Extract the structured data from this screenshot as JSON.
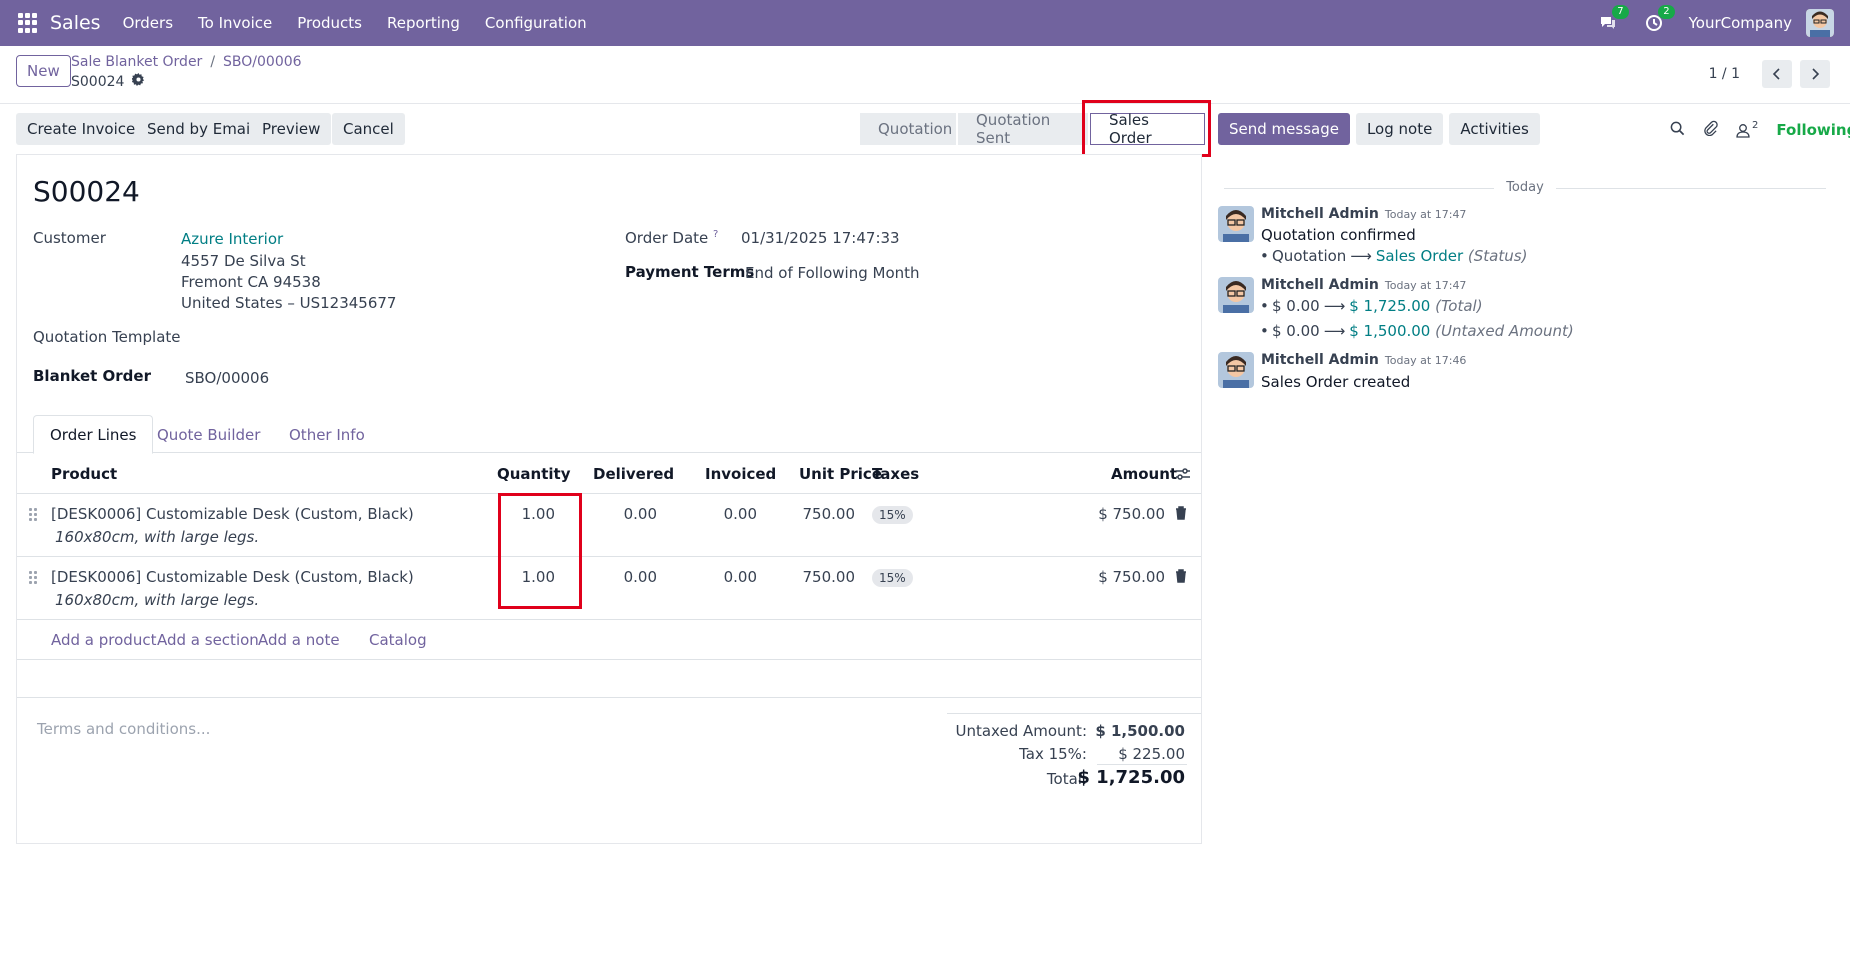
{
  "navbar": {
    "app": "Sales",
    "menu": [
      "Orders",
      "To Invoice",
      "Products",
      "Reporting",
      "Configuration"
    ],
    "messages_count": "7",
    "activities_count": "2",
    "company": "YourCompany"
  },
  "control_panel": {
    "new_label": "New",
    "breadcrumb_parent": "Sale Blanket Order",
    "breadcrumb_separator": "/",
    "breadcrumb_current": "SBO/00006",
    "record_name": "S00024",
    "pager": "1 / 1"
  },
  "actions": {
    "create_invoice": "Create Invoice",
    "send_by_email": "Send by Email",
    "preview": "Preview",
    "cancel": "Cancel"
  },
  "stages": [
    "Quotation",
    "Quotation Sent",
    "Sales Order"
  ],
  "chatter_actions": {
    "send_message": "Send message",
    "log_note": "Log note",
    "activities": "Activities",
    "followers_count": "2",
    "following": "Following"
  },
  "form": {
    "title": "S00024",
    "customer_label": "Customer",
    "customer_name": "Azure Interior",
    "address_line1": "4557 De Silva St",
    "address_line2": "Fremont CA 94538",
    "address_line3": "United States – US12345677",
    "quotation_template_label": "Quotation Template",
    "blanket_order_label": "Blanket Order",
    "blanket_order_value": "SBO/00006",
    "order_date_label": "Order Date",
    "order_date_help": "?",
    "order_date_value": "01/31/2025 17:47:33",
    "payment_terms_label": "Payment Terms",
    "payment_terms_value": "End of Following Month"
  },
  "tabs": [
    "Order Lines",
    "Quote Builder",
    "Other Info"
  ],
  "table": {
    "headers": {
      "product": "Product",
      "quantity": "Quantity",
      "delivered": "Delivered",
      "invoiced": "Invoiced",
      "unit_price": "Unit Price",
      "taxes": "Taxes",
      "amount": "Amount"
    },
    "rows": [
      {
        "product": "[DESK0006] Customizable Desk (Custom, Black)",
        "description": "160x80cm, with large legs.",
        "quantity": "1.00",
        "delivered": "0.00",
        "invoiced": "0.00",
        "unit_price": "750.00",
        "tax": "15%",
        "amount": "$ 750.00"
      },
      {
        "product": "[DESK0006] Customizable Desk (Custom, Black)",
        "description": "160x80cm, with large legs.",
        "quantity": "1.00",
        "delivered": "0.00",
        "invoiced": "0.00",
        "unit_price": "750.00",
        "tax": "15%",
        "amount": "$ 750.00"
      }
    ],
    "add_product": "Add a product",
    "add_section": "Add a section",
    "add_note": "Add a note",
    "catalog": "Catalog"
  },
  "terms_placeholder": "Terms and conditions...",
  "totals": {
    "untaxed_label": "Untaxed Amount:",
    "untaxed_value": "$ 1,500.00",
    "tax_label": "Tax 15%:",
    "tax_value": "$ 225.00",
    "total_label": "Total:",
    "total_value": "$ 1,725.00"
  },
  "chatter": {
    "today": "Today",
    "messages": [
      {
        "author": "Mitchell Admin",
        "time": "Today at 17:47",
        "body": "Quotation confirmed",
        "old": "Quotation",
        "new": "Sales Order",
        "field": "(Status)"
      },
      {
        "author": "Mitchell Admin",
        "time": "Today at 17:47",
        "changes": [
          {
            "old": "$ 0.00",
            "new": "$ 1,725.00",
            "field": "(Total)"
          },
          {
            "old": "$ 0.00",
            "new": "$ 1,500.00",
            "field": "(Untaxed Amount)"
          }
        ]
      },
      {
        "author": "Mitchell Admin",
        "time": "Today at 17:46",
        "body": "Sales Order created"
      }
    ],
    "arrow": "⟶"
  },
  "colors": {
    "navbar": "#71639e",
    "link": "#017e84",
    "highlight": "#e0001b",
    "following": "#17a948"
  }
}
